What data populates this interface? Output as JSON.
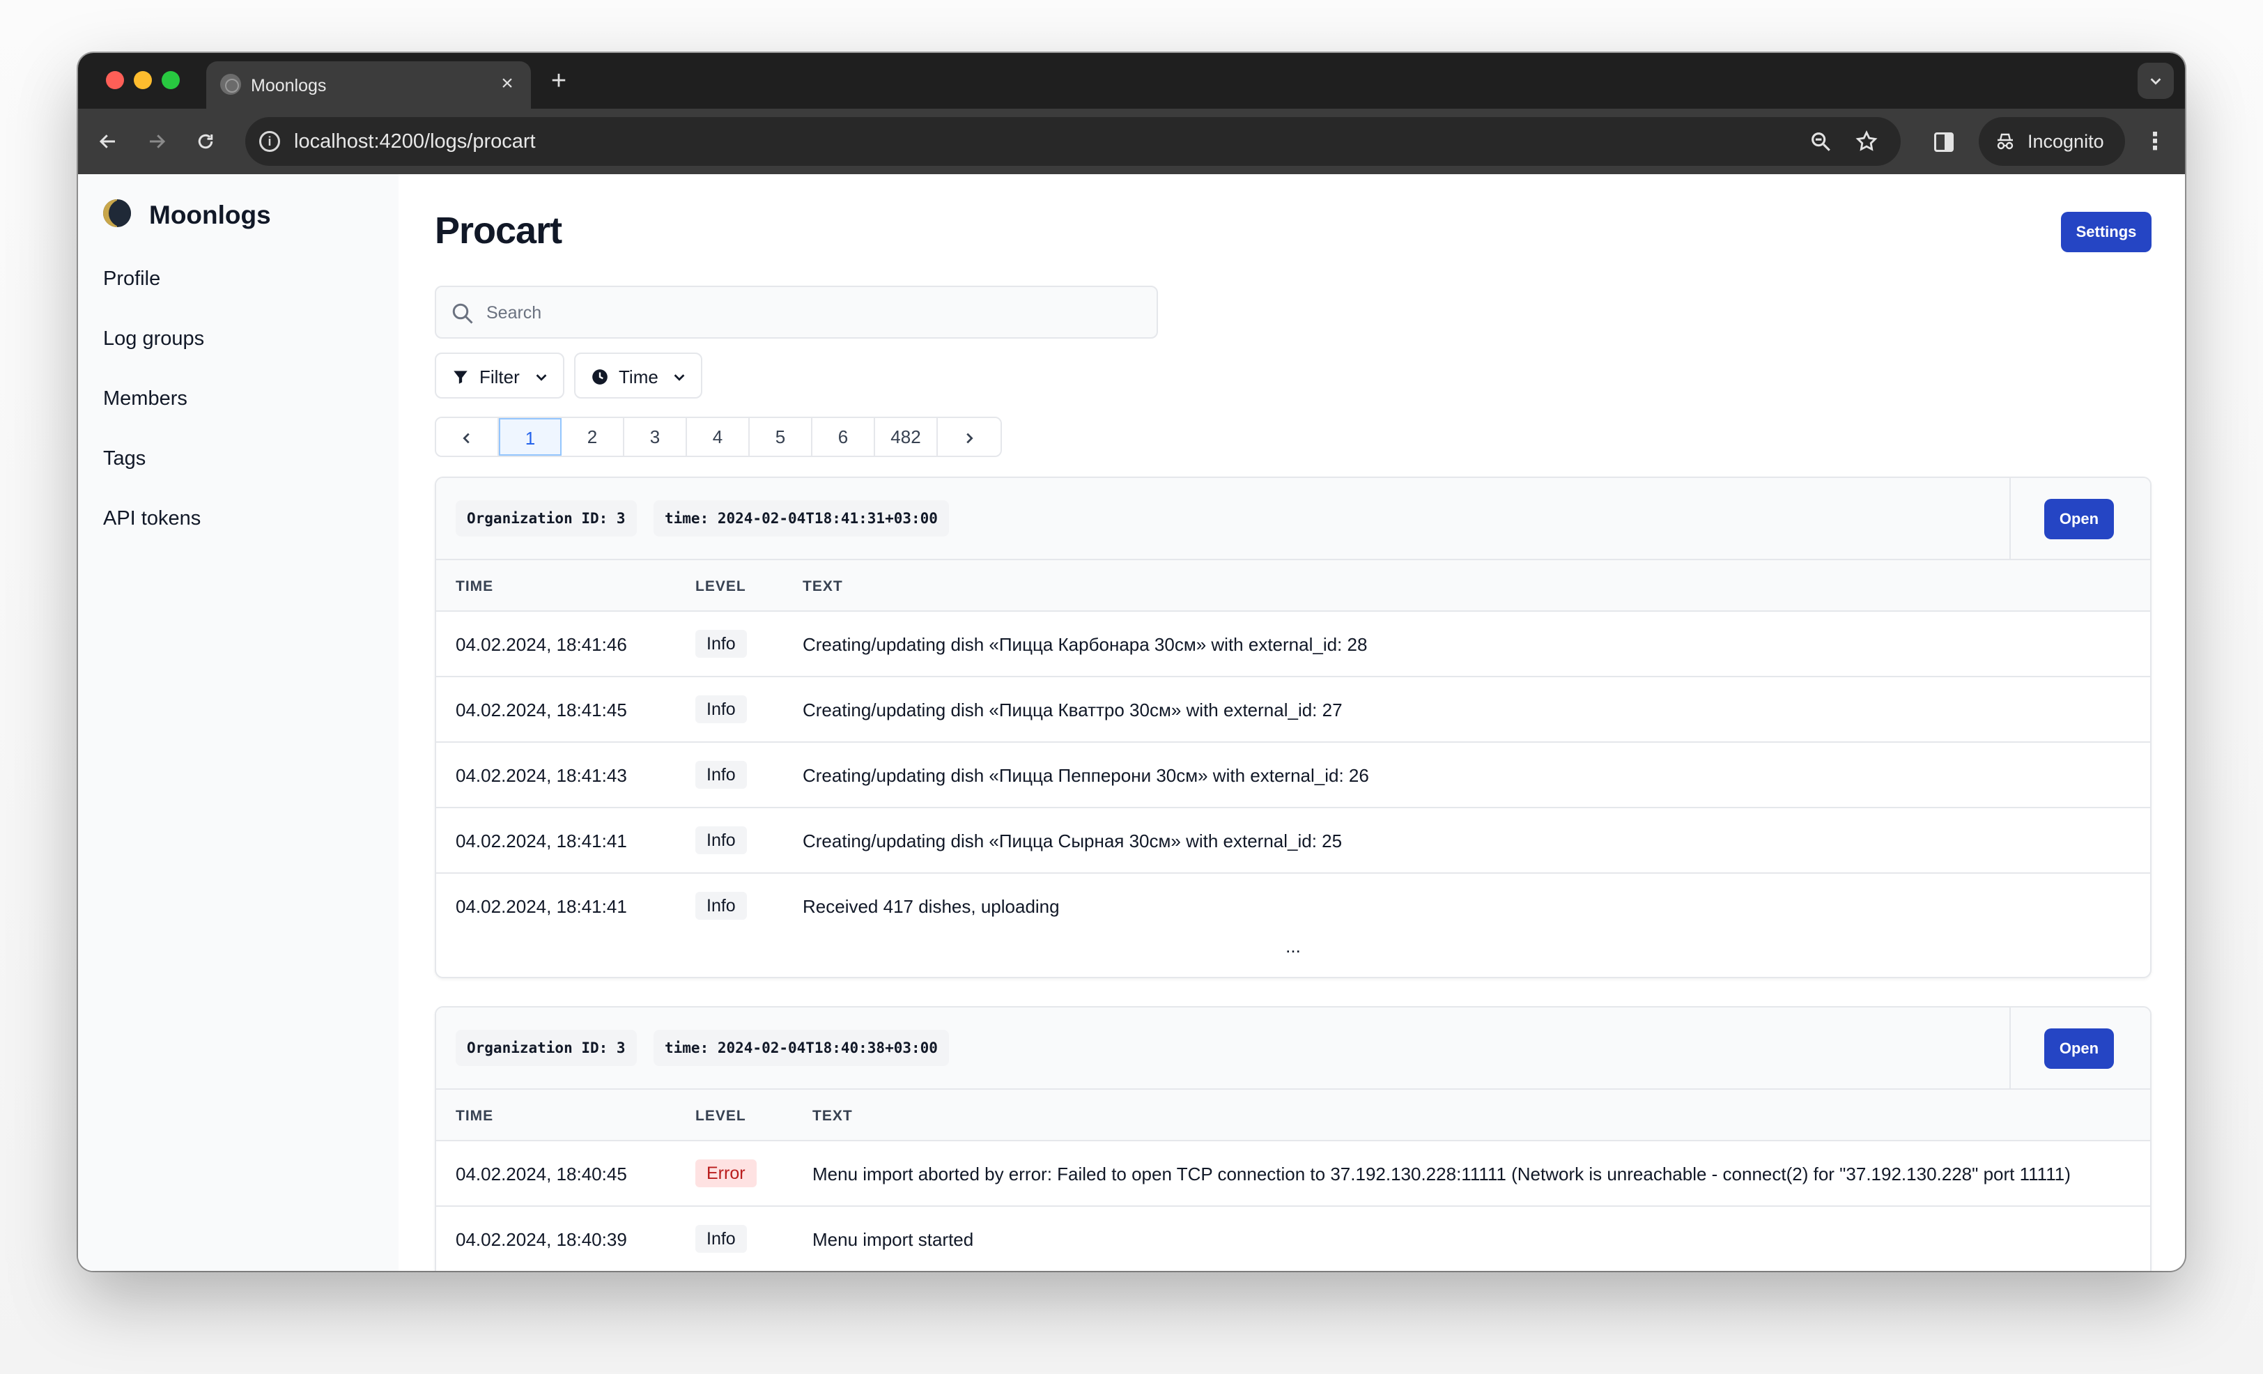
{
  "browser": {
    "tab_title": "Moonlogs",
    "tab_close": "×",
    "new_tab": "+",
    "url": "localhost:4200/logs/procart",
    "incognito_label": "Incognito"
  },
  "sidebar": {
    "brand": "Moonlogs",
    "items": [
      {
        "label": "Profile"
      },
      {
        "label": "Log groups"
      },
      {
        "label": "Members"
      },
      {
        "label": "Tags"
      },
      {
        "label": "API tokens"
      }
    ]
  },
  "main": {
    "title": "Procart",
    "settings_label": "Settings",
    "search_placeholder": "Search",
    "filter_label": "Filter",
    "time_label": "Time",
    "pagination": [
      "1",
      "2",
      "3",
      "4",
      "5",
      "6",
      "482"
    ],
    "active_page": "1"
  },
  "columns": {
    "time": "TIME",
    "level": "LEVEL",
    "text": "TEXT"
  },
  "cards": [
    {
      "tags": [
        "Organization ID: 3",
        "time: 2024-02-04T18:41:31+03:00"
      ],
      "open_label": "Open",
      "rows": [
        {
          "time": "04.02.2024, 18:41:46",
          "level": "Info",
          "text": "Creating/updating dish «Пицца Карбонара 30см» with external_id: 28"
        },
        {
          "time": "04.02.2024, 18:41:45",
          "level": "Info",
          "text": "Creating/updating dish «Пицца Кваттро 30см» with external_id: 27"
        },
        {
          "time": "04.02.2024, 18:41:43",
          "level": "Info",
          "text": "Creating/updating dish «Пицца Пепперони 30см» with external_id: 26"
        },
        {
          "time": "04.02.2024, 18:41:41",
          "level": "Info",
          "text": "Creating/updating dish «Пицца Сырная 30см» with external_id: 25"
        },
        {
          "time": "04.02.2024, 18:41:41",
          "level": "Info",
          "text": "Received 417 dishes, uploading"
        }
      ],
      "more": "..."
    },
    {
      "tags": [
        "Organization ID: 3",
        "time: 2024-02-04T18:40:38+03:00"
      ],
      "open_label": "Open",
      "rows": [
        {
          "time": "04.02.2024, 18:40:45",
          "level": "Error",
          "text": "Menu import aborted by error: Failed to open TCP connection to 37.192.130.228:11111 (Network is unreachable - connect(2) for \"37.192.130.228\" port 11111)"
        },
        {
          "time": "04.02.2024, 18:40:39",
          "level": "Info",
          "text": "Menu import started"
        }
      ]
    }
  ],
  "colors": {
    "accent": "#2545c4",
    "error_bg": "#fee2e2",
    "error_text": "#b91c1c"
  }
}
